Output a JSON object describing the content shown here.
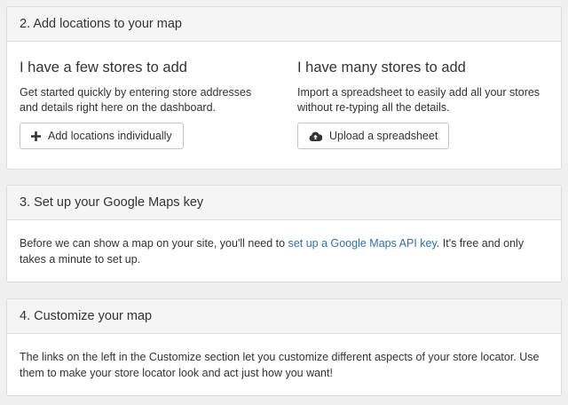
{
  "section2": {
    "title": "2. Add locations to your map",
    "few": {
      "heading": "I have a few stores to add",
      "description": "Get started quickly by entering store addresses and details right here on the dashboard.",
      "button_label": "Add locations individually",
      "button_icon": "plus-icon"
    },
    "many": {
      "heading": "I have many stores to add",
      "description": "Import a spreadsheet to easily add all your stores without re-typing all the details.",
      "button_label": "Upload a spreadsheet",
      "button_icon": "cloud-upload-icon"
    }
  },
  "section3": {
    "title": "3. Set up your Google Maps key",
    "text_before": "Before we can show a map on your site, you'll need to ",
    "link_text": "set up a Google Maps API key",
    "text_after": ". It's free and only takes a minute to set up."
  },
  "section4": {
    "title": "4. Customize your map",
    "text": "The links on the left in the Customize section let you customize different aspects of your store locator. Use them to make your store locator look and act just how you want!"
  },
  "colors": {
    "link": "#2a73b9",
    "panel_header_bg": "#f5f5f5",
    "page_bg": "#f0f0f0"
  }
}
